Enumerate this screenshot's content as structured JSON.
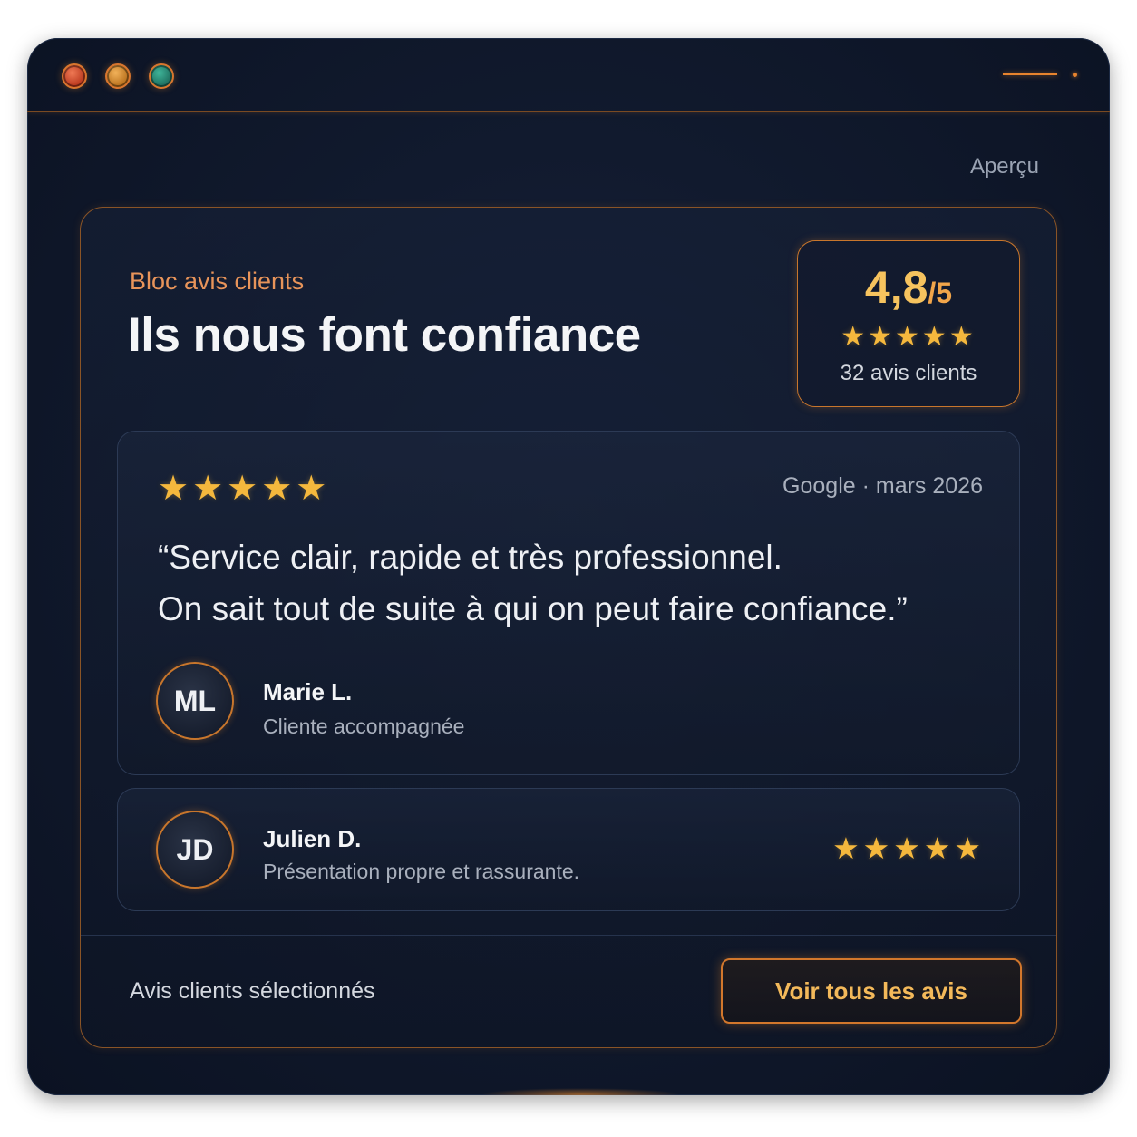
{
  "window": {
    "controls": [
      "close",
      "minimize",
      "maximize"
    ],
    "accent_color": "#e8842e"
  },
  "preview_label": "Aperçu",
  "block": {
    "eyebrow": "Bloc avis clients",
    "headline": "Ils nous font confiance"
  },
  "rating": {
    "value": "4,8",
    "max": "/5",
    "stars": "★★★★★",
    "stars_count": 5,
    "count_label": "32 avis clients"
  },
  "reviews": [
    {
      "stars": "★★★★★",
      "stars_count": 5,
      "source": "Google · mars 2026",
      "quote_lines": [
        "“Service clair, rapide et très professionnel.",
        "On sait tout de suite à qui on peut faire confiance.”"
      ],
      "initials": "ML",
      "name": "Marie L.",
      "role": "Cliente accompagnée"
    },
    {
      "stars": "★★★★★",
      "stars_count": 5,
      "initials": "JD",
      "name": "Julien D.",
      "role": "Présentation propre et rassurante."
    }
  ],
  "footer": {
    "text": "Avis clients sélectionnés",
    "cta_label": "Voir tous les avis"
  },
  "colors": {
    "background": "#111a2e",
    "accent_orange": "#e8842e",
    "star_gold": "#f5b83d",
    "text_primary": "#f4f5f7",
    "text_muted": "#a9b0bd"
  }
}
